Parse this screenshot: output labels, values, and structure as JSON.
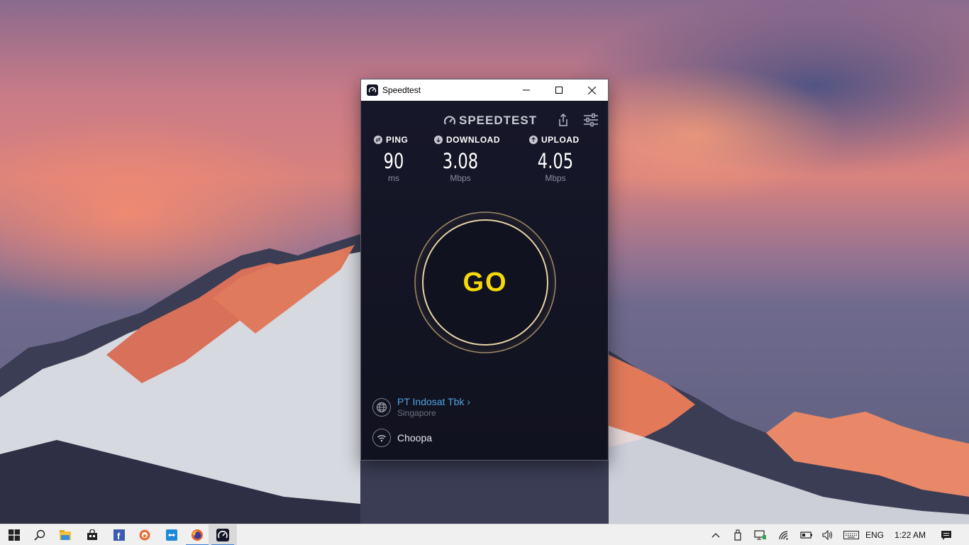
{
  "window": {
    "title": "Speedtest"
  },
  "app": {
    "brand": "SPEEDTEST",
    "metrics": {
      "ping": {
        "label": "PING",
        "value": "90",
        "unit": "ms"
      },
      "download": {
        "label": "DOWNLOAD",
        "value": "3.08",
        "unit": "Mbps"
      },
      "upload": {
        "label": "UPLOAD",
        "value": "4.05",
        "unit": "Mbps"
      }
    },
    "go_label": "GO",
    "server": {
      "isp": "PT Indosat Tbk",
      "chevron": "›",
      "location": "Singapore"
    },
    "host": "Choopa"
  },
  "colors": {
    "go_yellow": "#f5d90a",
    "isp_blue": "#4fa3e0",
    "ring_gold": "#e8c98a",
    "app_bg": "#141526"
  },
  "taskbar": {
    "items": [
      "start-icon",
      "search-icon",
      "file-explorer-icon",
      "store-icon",
      "facebook-icon",
      "app-orange-icon",
      "teamviewer-icon",
      "firefox-icon",
      "speedtest-icon"
    ],
    "tray": {
      "language": "ENG",
      "time": "1:22 AM"
    }
  }
}
